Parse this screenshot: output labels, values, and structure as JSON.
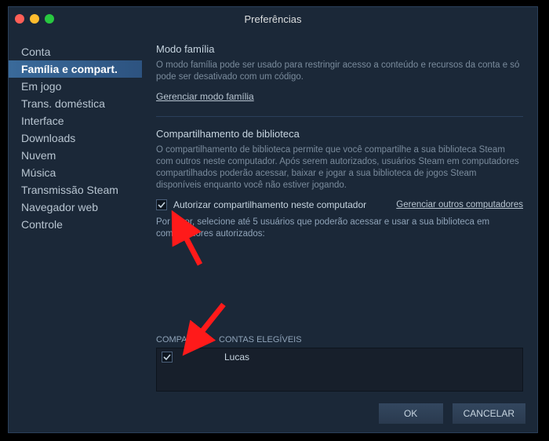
{
  "window": {
    "title": "Preferências"
  },
  "sidebar": {
    "items": [
      {
        "label": "Conta"
      },
      {
        "label": "Família e compart."
      },
      {
        "label": "Em jogo"
      },
      {
        "label": "Trans. doméstica"
      },
      {
        "label": "Interface"
      },
      {
        "label": "Downloads"
      },
      {
        "label": "Nuvem"
      },
      {
        "label": "Música"
      },
      {
        "label": "Transmissão Steam"
      },
      {
        "label": "Navegador web"
      },
      {
        "label": "Controle"
      }
    ],
    "activeIndex": 1
  },
  "family": {
    "title": "Modo família",
    "desc": "O modo família pode ser usado para restringir acesso a conteúdo e recursos da conta e só pode ser desativado com um código.",
    "manage_link": "Gerenciar modo família"
  },
  "sharing": {
    "title": "Compartilhamento de biblioteca",
    "desc": "O compartilhamento de biblioteca permite que você compartilhe a sua biblioteca Steam com outros neste computador. Após serem autorizados, usuários Steam em computadores compartilhados poderão acessar, baixar e jogar a sua biblioteca de jogos Steam disponíveis enquanto você não estiver jogando.",
    "authorize_label": "Autorizar compartilhamento neste computador",
    "authorize_checked": true,
    "manage_others_link": "Gerenciar outros computadores",
    "hint": "Por favor, selecione até 5 usuários que poderão acessar e usar a sua biblioteca em computadores autorizados:"
  },
  "accounts": {
    "col_share": "COMPART.",
    "col_eligible": "CONTAS ELEGÍVEIS",
    "rows": [
      {
        "checked": true,
        "name": "Lucas"
      }
    ]
  },
  "footer": {
    "ok": "OK",
    "cancel": "CANCELAR"
  }
}
